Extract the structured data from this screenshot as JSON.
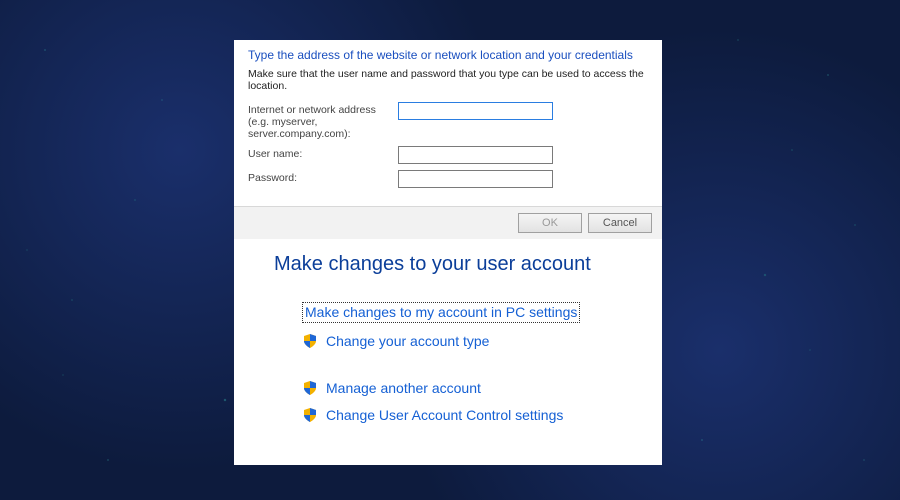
{
  "credentials_dialog": {
    "heading": "Type the address of the website or network location and your credentials",
    "hint": "Make sure that the user name and password that you type can be used to access the location.",
    "fields": {
      "address": {
        "label": "Internet or network address\n(e.g. myserver, server.company.com):",
        "value": ""
      },
      "username": {
        "label": "User name:",
        "value": ""
      },
      "password": {
        "label": "Password:",
        "value": ""
      }
    },
    "buttons": {
      "ok": "OK",
      "cancel": "Cancel"
    }
  },
  "user_accounts": {
    "heading": "Make changes to your user account",
    "links": [
      {
        "id": "pc-settings",
        "label": "Make changes to my account in PC settings",
        "shield": false,
        "focused": true
      },
      {
        "id": "change-type",
        "label": "Change your account type",
        "shield": true
      },
      {
        "id": "manage-another",
        "label": "Manage another account",
        "shield": true
      },
      {
        "id": "uac-settings",
        "label": "Change User Account Control settings",
        "shield": true
      }
    ]
  }
}
